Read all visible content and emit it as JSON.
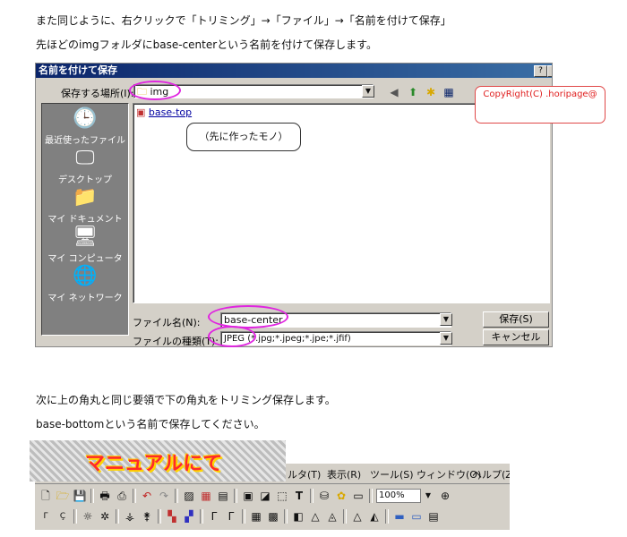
{
  "text": {
    "line1": "また同じように、右クリックで「トリミング」→「ファイル」→「名前を付けて保存」",
    "line2": "先ほどのimgフォルダにbase-centerという名前を付けて保存します。",
    "line3": "次に上の角丸と同じ要領で下の角丸をトリミング保存します。",
    "line4": "base-bottomという名前で保存してください。"
  },
  "dialog": {
    "title": "名前を付けて保存",
    "help_btn": "?",
    "close_btn": "×",
    "save_in_label": "保存する場所(I):",
    "save_in_value": "img",
    "places": [
      "最近使ったファイル",
      "デスクトップ",
      "マイ ドキュメント",
      "マイ コンピュータ",
      "マイ ネットワーク"
    ],
    "file_item": "base-top",
    "filename_label": "ファイル名(N):",
    "filename_value": "base-center",
    "filetype_label": "ファイルの種類(T):",
    "filetype_value": "JPEG (*.jpg;*.jpeg;*.jpe;*.jfif)",
    "save_button": "保存(S)",
    "cancel_button": "キャンセル"
  },
  "callout": "（先に作ったモノ）",
  "copyright": "CopyRight(C) .horipage@",
  "toolbar": {
    "banner": "マニュアルにて",
    "menu": [
      "ルタ(T)",
      "表示(R)",
      "ツール(S)",
      "ウィンドウ(O)",
      "ヘルプ(Z)"
    ],
    "zoom": "100%"
  },
  "colors": {
    "annotation": "#e025e0",
    "title_bar": "#0a246a",
    "banner_text": "#ff2a2a"
  }
}
